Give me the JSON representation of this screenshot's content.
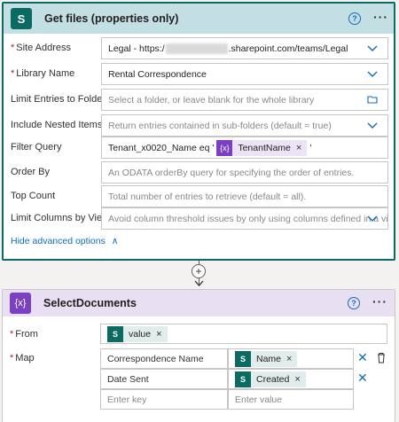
{
  "get_files": {
    "title": "Get files (properties only)",
    "icon_label": "S",
    "fields": [
      {
        "label": "Site Address",
        "required": true,
        "prefix": "Legal - https:/",
        "suffix": ".sharepoint.com/teams/Legal",
        "type": "dropdown"
      },
      {
        "label": "Library Name",
        "required": true,
        "value": "Rental Correspondence",
        "type": "dropdown"
      },
      {
        "label": "Limit Entries to Folder",
        "required": false,
        "placeholder": "Select a folder, or leave blank for the whole library",
        "type": "folder"
      },
      {
        "label": "Include Nested Items",
        "required": false,
        "placeholder": "Return entries contained in sub-folders (default = true)",
        "type": "dropdown"
      },
      {
        "label": "Filter Query",
        "required": false,
        "text_before": "Tenant_x0020_Name eq '",
        "token": "TenantName",
        "text_after": "'",
        "type": "text"
      },
      {
        "label": "Order By",
        "required": false,
        "placeholder": "An ODATA orderBy query for specifying the order of entries.",
        "type": "text"
      },
      {
        "label": "Top Count",
        "required": false,
        "placeholder": "Total number of entries to retrieve (default = all).",
        "type": "text"
      },
      {
        "label": "Limit Columns by View",
        "required": false,
        "placeholder": "Avoid column threshold issues by only using columns defined in a view",
        "type": "dropdown"
      }
    ],
    "advanced_toggle": "Hide advanced options"
  },
  "select": {
    "title": "SelectDocuments",
    "icon_label": "{x}",
    "from_label": "From",
    "from_token": "value",
    "map_label": "Map",
    "map_rows": [
      {
        "key": "Correspondence Name",
        "value_token": "Name"
      },
      {
        "key": "Date Sent",
        "value_token": "Created"
      }
    ],
    "key_placeholder": "Enter key",
    "value_placeholder": "Enter value"
  },
  "glyphs": {
    "help": "?",
    "more": "···",
    "close": "×",
    "remove": "✕",
    "var_token": "{x}",
    "sp_token": "S",
    "plus": "+",
    "req": "*",
    "caret_up": "∧"
  },
  "colors": {
    "sharepoint": "#0b6a62",
    "variable": "#7a3fc2",
    "link": "#0f6cbd",
    "header1": "#c4dfe3",
    "header2": "#e8dff2"
  }
}
